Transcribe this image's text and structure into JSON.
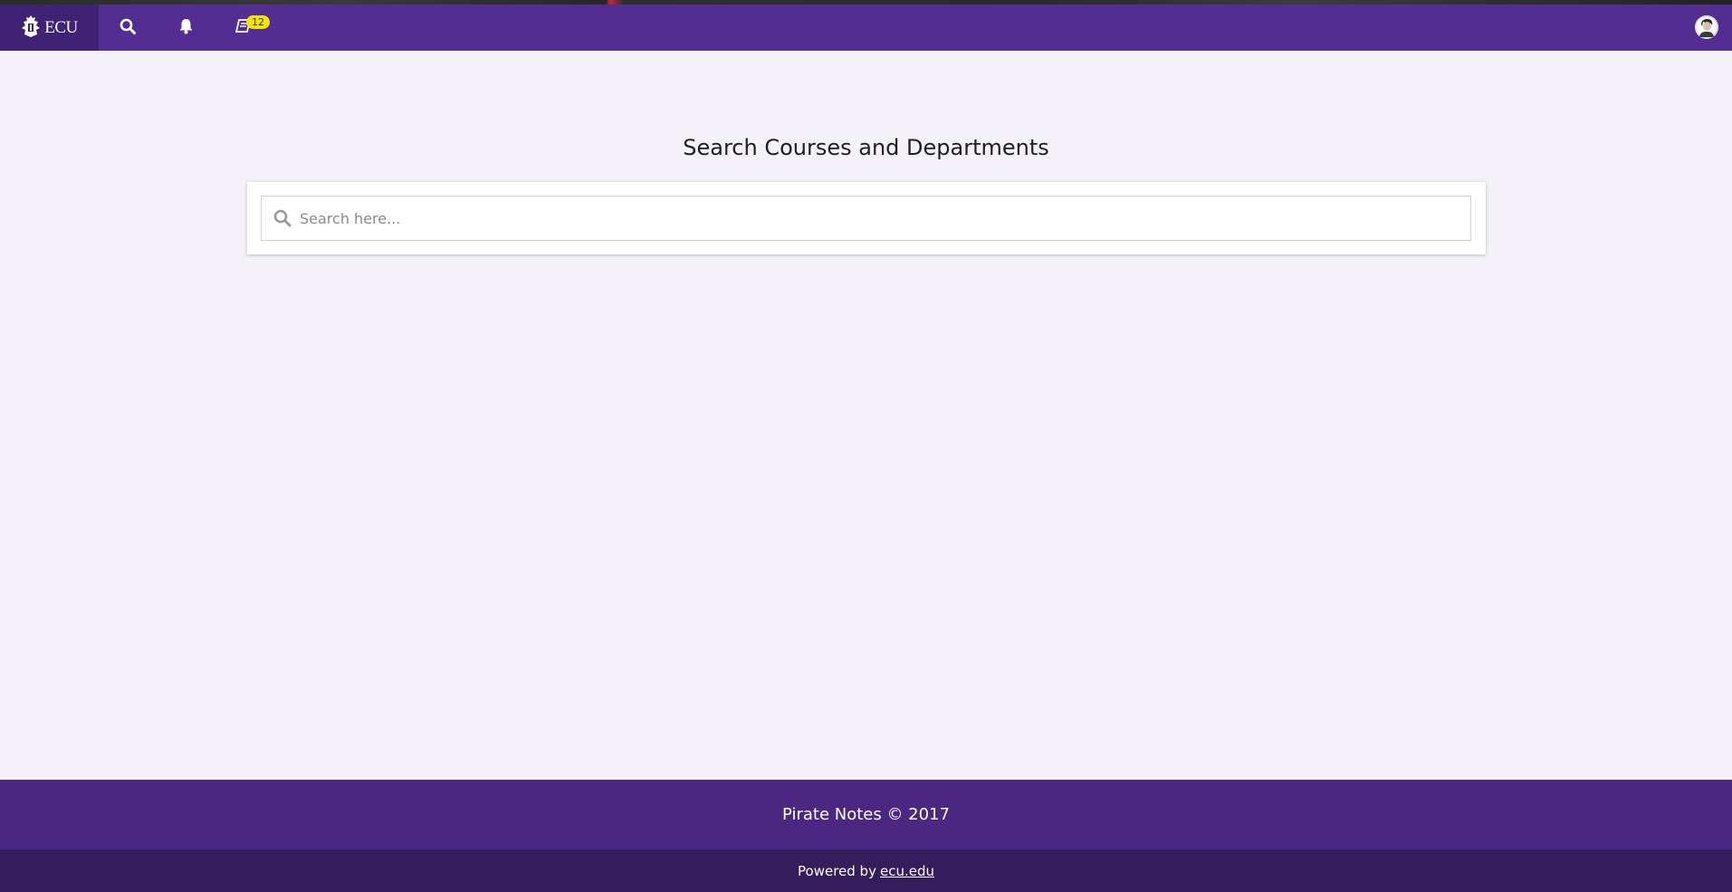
{
  "navbar": {
    "brand_text": "ECU",
    "icons": [
      "search-icon",
      "bell-icon",
      "book-icon"
    ],
    "notes_badge": "12",
    "colors": {
      "bar": "#532d91",
      "brand_bg": "#3f2273",
      "badge": "#f2e40a"
    }
  },
  "main": {
    "title": "Search Courses and Departments",
    "search_placeholder": "Search here..."
  },
  "footer": {
    "title": "Pirate Notes © 2017",
    "powered_prefix": "Powered by",
    "powered_link": "ecu.edu",
    "colors": {
      "main": "#4b2782",
      "sub": "#351c5c"
    }
  }
}
